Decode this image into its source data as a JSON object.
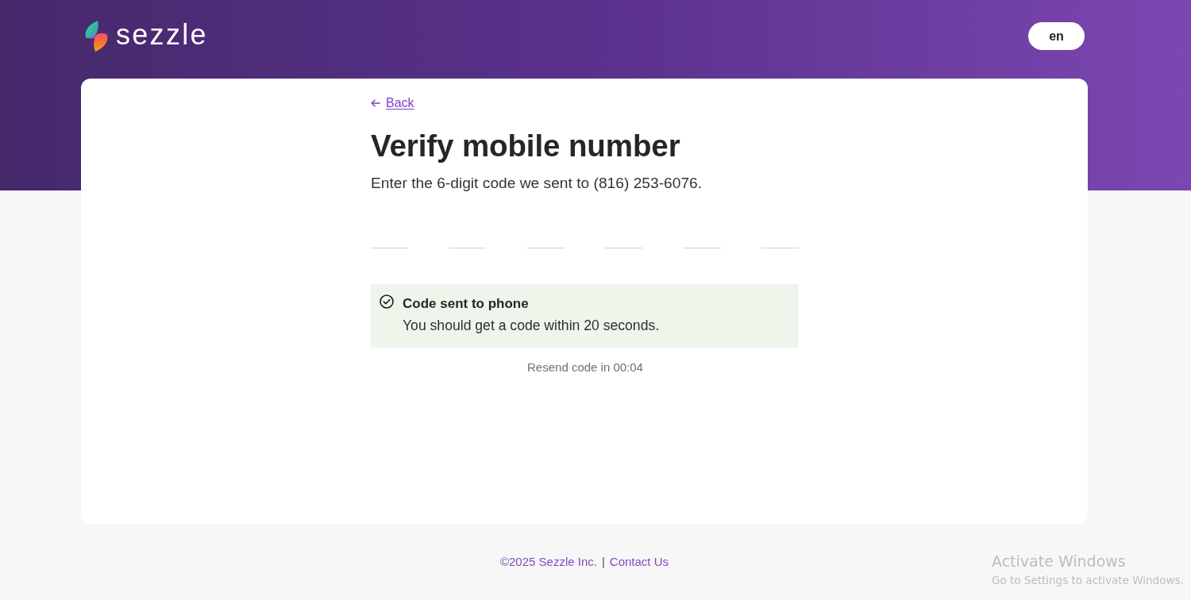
{
  "header": {
    "logo": {
      "text": "sezzle"
    },
    "language_button": {
      "label": "en"
    }
  },
  "card": {
    "back_link": {
      "label": "Back"
    },
    "title": "Verify mobile number",
    "instructions": "Enter the 6-digit code we sent to (816) 253-6076.",
    "code_fields": [
      {
        "focused": false
      },
      {
        "focused": false
      },
      {
        "focused": false
      },
      {
        "focused": false
      },
      {
        "focused": false
      },
      {
        "focused": false
      }
    ],
    "notice": {
      "title": "Code sent to phone",
      "message": "You should get a code within 20 seconds."
    },
    "resend_timer": "Resend code in 00:04"
  },
  "footer": {
    "copyright": "©2025 Sezzle Inc.",
    "separator": "|",
    "contact_link": "Contact Us"
  },
  "activation_notice": {
    "title": "Activate Windows",
    "message": "Go to Settings to activate Windows."
  }
}
